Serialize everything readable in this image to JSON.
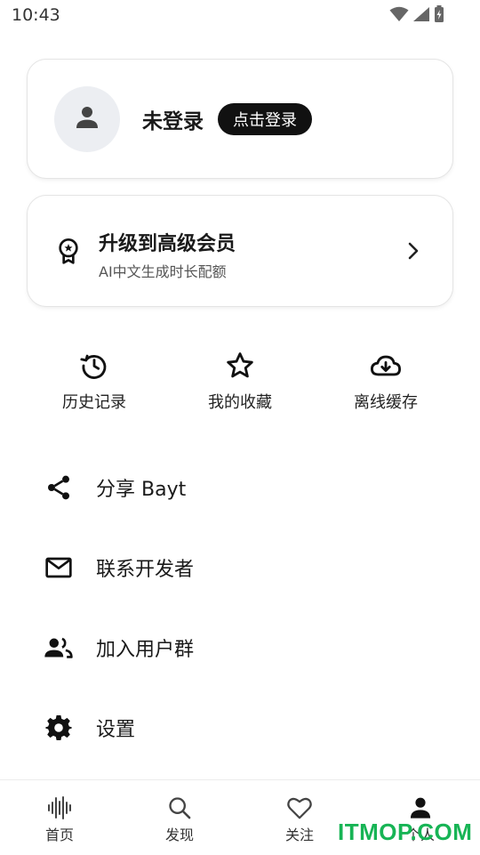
{
  "status_bar": {
    "time": "10:43"
  },
  "profile": {
    "name": "未登录",
    "login_button": "点击登录"
  },
  "vip": {
    "title": "升级到高级会员",
    "subtitle": "AI中文生成时长配额"
  },
  "quick_actions": [
    {
      "label": "历史记录",
      "icon": "history-icon"
    },
    {
      "label": "我的收藏",
      "icon": "star-icon"
    },
    {
      "label": "离线缓存",
      "icon": "cloud-download-icon"
    }
  ],
  "menu": [
    {
      "label": "分享 Bayt",
      "icon": "share-icon"
    },
    {
      "label": "联系开发者",
      "icon": "mail-icon"
    },
    {
      "label": "加入用户群",
      "icon": "group-icon"
    },
    {
      "label": "设置",
      "icon": "gear-icon"
    }
  ],
  "bottom_nav": [
    {
      "label": "首页",
      "icon": "soundwave-icon"
    },
    {
      "label": "发现",
      "icon": "search-icon"
    },
    {
      "label": "关注",
      "icon": "heart-icon"
    },
    {
      "label": "个人",
      "icon": "person-icon",
      "active": true
    }
  ],
  "watermark": "ITMOP.COM"
}
